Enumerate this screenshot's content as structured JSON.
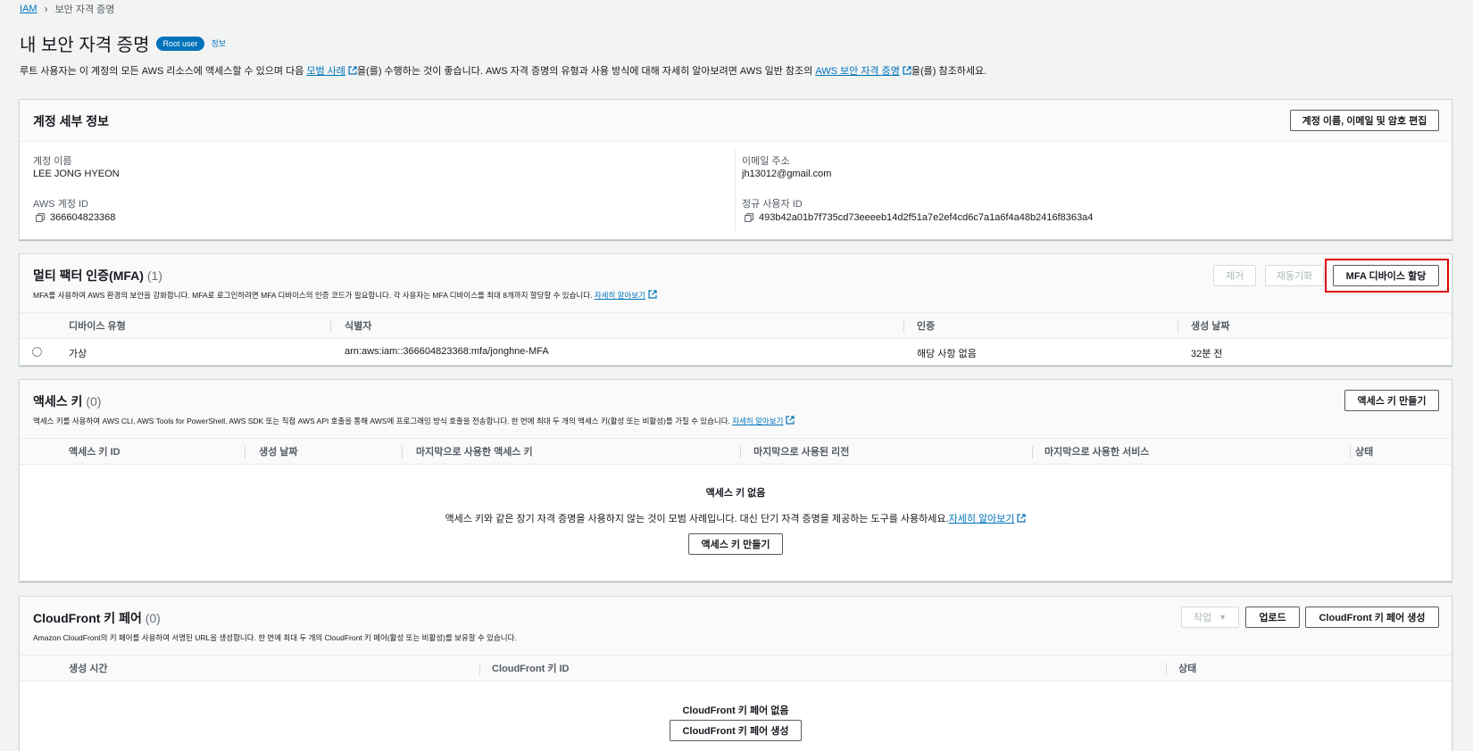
{
  "breadcrumb": {
    "root": "IAM",
    "current": "보안 자격 증명"
  },
  "header": {
    "title": "내 보안 자격 증명",
    "badge": "Root user",
    "info": "정보",
    "desc_part1": "루트 사용자는 이 계정의 모든 AWS 리소스에 액세스할 수 있으며 다음 ",
    "desc_link1": "모범 사례",
    "desc_part2": "을(를) 수행하는 것이 좋습니다. AWS 자격 증명의 유형과 사용 방식에 대해 자세히 알아보려면 AWS 일반 참조의 ",
    "desc_link2": "AWS 보안 자격 증명",
    "desc_part3": "을(를) 참조하세요."
  },
  "account": {
    "title": "계정 세부 정보",
    "edit_button": "계정 이름, 이메일 및 암호 편집",
    "name_label": "계정 이름",
    "name_value": "LEE JONG HYEON",
    "email_label": "이메일 주소",
    "email_value": "jh13012@gmail.com",
    "id_label": "AWS 계정 ID",
    "id_value": "366604823368",
    "canonical_label": "정규 사용자 ID",
    "canonical_value": "493b42a01b7f735cd73eeeeb14d2f51a7e2ef4cd6c7a1a6f4a48b2416f8363a4"
  },
  "mfa": {
    "title": "멀티 팩터 인증(MFA)",
    "count": "(1)",
    "desc": "MFA를 사용하여 AWS 환경의 보안을 강화합니다. MFA로 로그인하려면 MFA 디바이스의 인증 코드가 필요합니다. 각 사용자는 MFA 디바이스를 최대 8개까지 할당할 수 있습니다.",
    "learn_more": "자세히 알아보기",
    "remove_button": "제거",
    "resync_button": "재동기화",
    "assign_button": "MFA 디바이스 할당",
    "columns": [
      "디바이스 유형",
      "식별자",
      "인증",
      "생성 날짜"
    ],
    "rows": [
      {
        "type": "가상",
        "identifier": "arn:aws:iam::366604823368:mfa/jonghne-MFA",
        "certification": "해당 사항 없음",
        "created": "32분 전"
      }
    ]
  },
  "access_keys": {
    "title": "액세스 키",
    "count": "(0)",
    "desc": "액세스 키를 사용하여 AWS CLI, AWS Tools for PowerShell, AWS SDK 또는 직접 AWS API 호출을 통해 AWS에 프로그래밍 방식 호출을 전송합니다. 한 번에 최대 두 개의 액세스 키(활성 또는 비활성)를 가질 수 있습니다.",
    "learn_more": "자세히 알아보기",
    "create_button": "액세스 키 만들기",
    "columns": [
      "액세스 키 ID",
      "생성 날짜",
      "마지막으로 사용한 액세스 키",
      "마지막으로 사용된 리전",
      "마지막으로 사용한 서비스",
      "상태"
    ],
    "empty_title": "액세스 키 없음",
    "empty_desc": "액세스 키와 같은 장기 자격 증명을 사용하지 않는 것이 모범 사례입니다. 대신 단기 자격 증명을 제공하는 도구를 사용하세요.",
    "empty_link": "자세히 알아보기",
    "empty_button": "액세스 키 만들기"
  },
  "cloudfront": {
    "title": "CloudFront 키 페어",
    "count": "(0)",
    "desc": "Amazon CloudFront의 키 페어를 사용하여 서명된 URL을 생성합니다. 한 번에 최대 두 개의 CloudFront 키 페어(활성 또는 비활성)를 보유할 수 있습니다.",
    "actions_button": "작업",
    "upload_button": "업로드",
    "create_button": "CloudFront 키 페어 생성",
    "columns": [
      "생성 시간",
      "CloudFront 키 ID",
      "상태"
    ],
    "empty_title": "CloudFront 키 페어 없음",
    "empty_button": "CloudFront 키 페어 생성"
  },
  "colors": {
    "link": "#0073bb",
    "highlight": "#e00000",
    "badge": "#0073bb"
  }
}
